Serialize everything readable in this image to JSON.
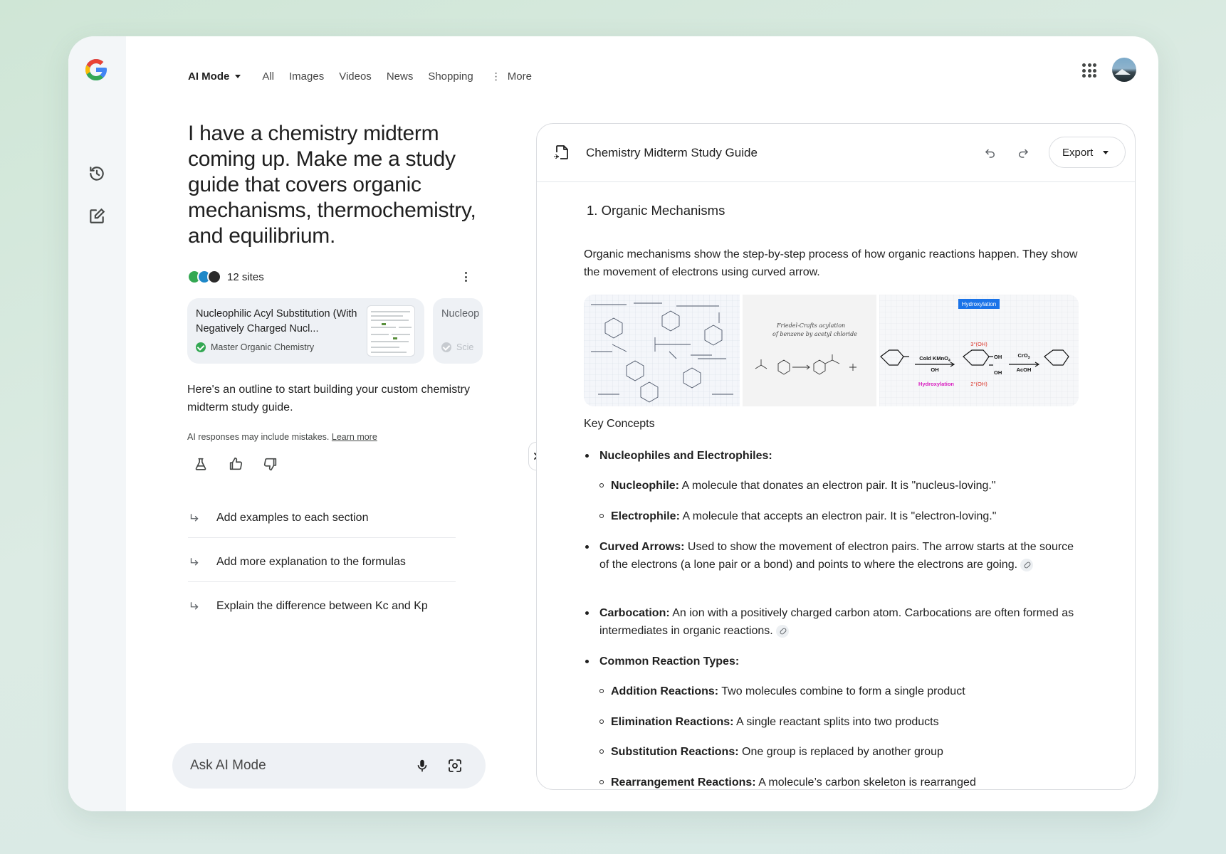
{
  "nav": {
    "mode": "AI Mode",
    "tabs": [
      "All",
      "Images",
      "Videos",
      "News",
      "Shopping"
    ],
    "more": "More"
  },
  "query": "I have a chemistry midterm coming up. Make me a study guide that covers organic mechanisms, thermochemistry, and equilibrium.",
  "sources": {
    "count": "12 sites",
    "cards": [
      {
        "title": "Nucleophilic Acyl Substitution (With Negatively Charged Nucl...",
        "source": "Master Organic Chemistry"
      },
      {
        "title": "Nucleop",
        "source": "Scie"
      }
    ]
  },
  "intro": "Here's an outline to start building your custom chemistry midterm study guide.",
  "disclaimer": {
    "text": "AI responses may include mistakes.",
    "link": "Learn more"
  },
  "suggestions": [
    "Add examples to each section",
    "Add more explanation to the formulas",
    "Explain the difference between Kc and Kp"
  ],
  "ask": {
    "placeholder": "Ask AI Mode"
  },
  "doc": {
    "title": "Chemistry Midterm Study Guide",
    "export_label": "Export",
    "section_title": "1. Organic Mechanisms",
    "paragraph": "Organic mechanisms show the step-by-step process of how organic reactions happen. They show the movement of electrons using curved arrow.",
    "image_labels": {
      "img2_line1": "Friedel-Crafts acylation",
      "img2_line2": "of benzene by acetyl chloride",
      "img3_badge": "Hydroxylation",
      "img3_reagent1": "Cold KMnO",
      "img3_reagent1_sub": "4",
      "img3_reagent1_b": "OH",
      "img3_label": "Hydroxylation",
      "img3_oh_top": "3°(OH)",
      "img3_oh_bot": "2°(OH)",
      "img3_oh1": "OH",
      "img3_oh2": "OH",
      "img3_reagent2": "CrO",
      "img3_reagent2_sub": "3",
      "img3_reagent2_b": "AcOH"
    },
    "key_concepts": "Key Concepts",
    "bullets": {
      "nuc_elec": "Nucleophiles and Electrophiles:",
      "nucleophile_term": "Nucleophile:",
      "nucleophile_text": " A molecule that donates an electron pair. It is \"nucleus-loving.\"",
      "electrophile_term": "Electrophile:",
      "electrophile_text": " A molecule that accepts an electron pair. It is \"electron-loving.\"",
      "curved_term": "Curved Arrows:",
      "curved_text": " Used to show the movement of electron pairs. The arrow starts at the source of the electrons (a lone pair or a bond) and points to where the electrons are going.",
      "carbocation_term": "Carbocation:",
      "carbocation_text": "  An ion with a positively charged carbon atom. Carbocations are often formed as intermediates in organic reactions.",
      "common_types": "Common Reaction Types:",
      "addition_term": "Addition Reactions:",
      "addition_text": " Two molecules combine to form a single product",
      "elimination_term": "Elimination Reactions:",
      "elimination_text": " A single reactant splits into two products",
      "substitution_term": "Substitution Reactions:",
      "substitution_text": " One group is replaced by another group",
      "rearrangement_term": "Rearrangement Reactions:",
      "rearrangement_text": " A molecule’s carbon skeleton is rearranged"
    }
  },
  "colors": {
    "accent_green": "#34a853",
    "badge_blue": "#1a73e8",
    "magenta": "#d81bbf",
    "red": "#d93025"
  }
}
